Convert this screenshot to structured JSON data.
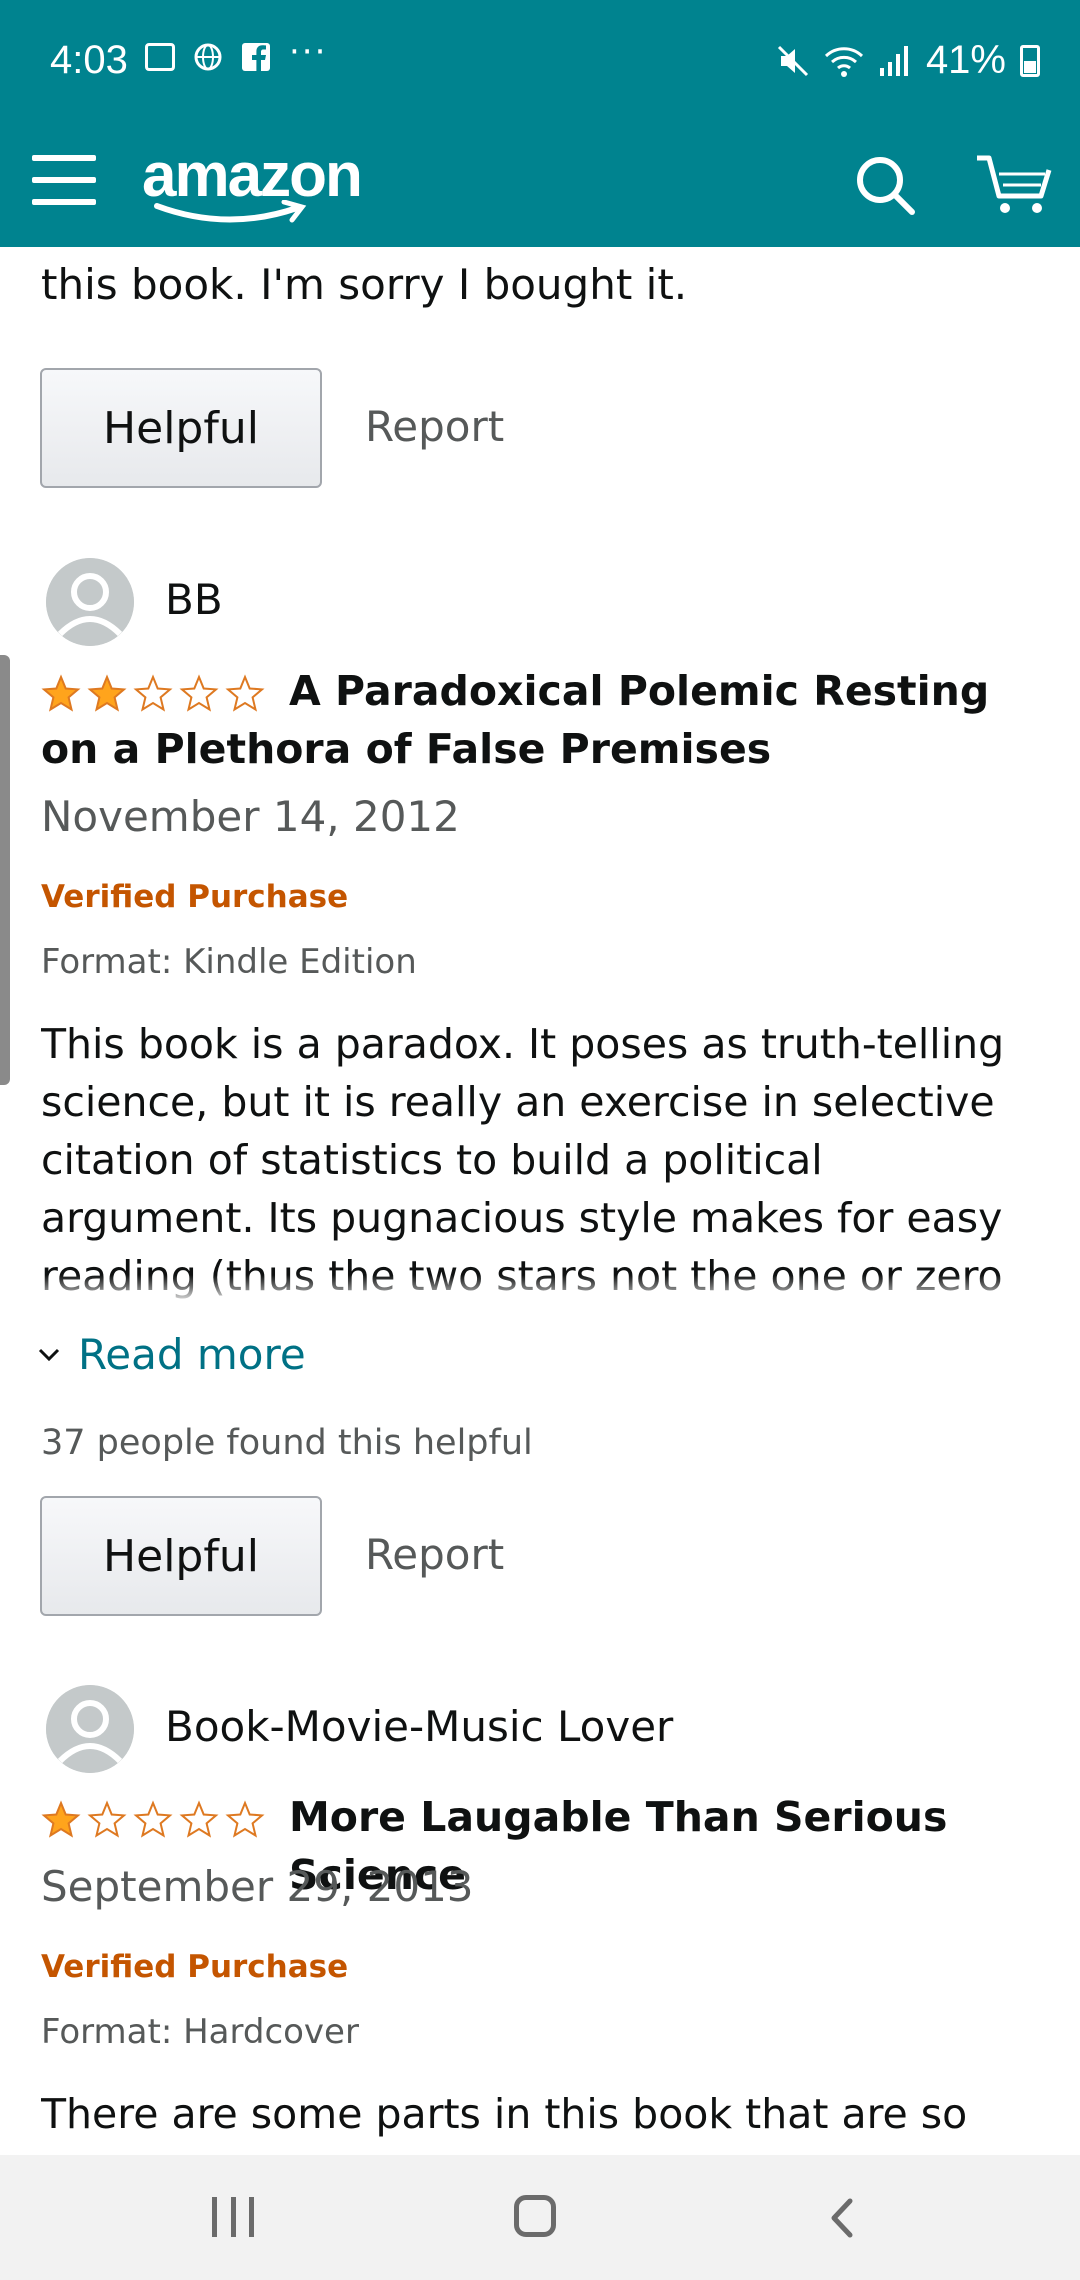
{
  "status_bar": {
    "time": "4:03",
    "battery": "41%",
    "more": "···"
  },
  "header": {
    "logo": "amazon"
  },
  "partial_review": {
    "text_tail": "this book. I'm sorry I bought it.",
    "helpful_label": "Helpful",
    "report_label": "Report"
  },
  "reviews": [
    {
      "author": "BB",
      "rating": 2,
      "title": "A Paradoxical Polemic Resting on a Plethora of False Premises",
      "date": "November 14, 2012",
      "verified": "Verified Purchase",
      "format": "Format: Kindle Edition",
      "body": "This book is a paradox. It poses as truth-telling science, but it is really an exercise in selective citation of statistics to build a political argument. Its pugnacious style makes for easy reading (thus the two stars not the one or zero the content deserves), but that should be regarded as a danger.",
      "read_more": "Read more",
      "helpful_count": "37 people found this helpful",
      "helpful_label": "Helpful",
      "report_label": "Report"
    },
    {
      "author": "Book-Movie-Music Lover",
      "rating": 1,
      "title": "More Laugable Than Serious Science",
      "date": "September 29, 2013",
      "verified": "Verified Purchase",
      "format": "Format: Hardcover",
      "body": "There are some parts in this book that are so"
    }
  ],
  "colors": {
    "header": "#00838f",
    "verified": "#c45500",
    "link": "#007185",
    "star": "#ffa41c"
  }
}
